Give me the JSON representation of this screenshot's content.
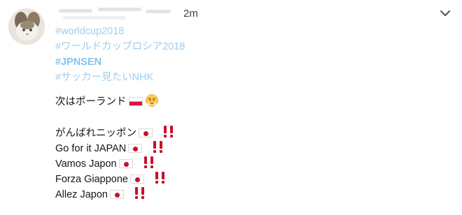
{
  "tweet": {
    "timestamp": "2m",
    "hashtags": [
      "#worldcup2018",
      "#ワールドカップロシア2018",
      "#JPNSEN",
      "#サッカー見たいNHK"
    ],
    "next_line": "次はポーランド",
    "cheer_lines": [
      "がんばれニッポン",
      "Go for it JAPAN",
      "Vamos Japon",
      "Forza Giappone",
      "Allez Japon"
    ]
  },
  "colors": {
    "hashtag": "#9ccfee",
    "hashtag_bold": "#83c3ea",
    "text": "#14171a",
    "exclamation": "#c8102e",
    "timestamp": "#3a3f44"
  },
  "icons": {
    "avatar": "rabbit-photo",
    "caret": "chevron-down-icon",
    "flag_poland": "poland-flag-icon",
    "flag_japan": "japan-flag-icon",
    "face": "steam-from-nose-face-icon",
    "exclamation": "double-exclamation-icon"
  }
}
